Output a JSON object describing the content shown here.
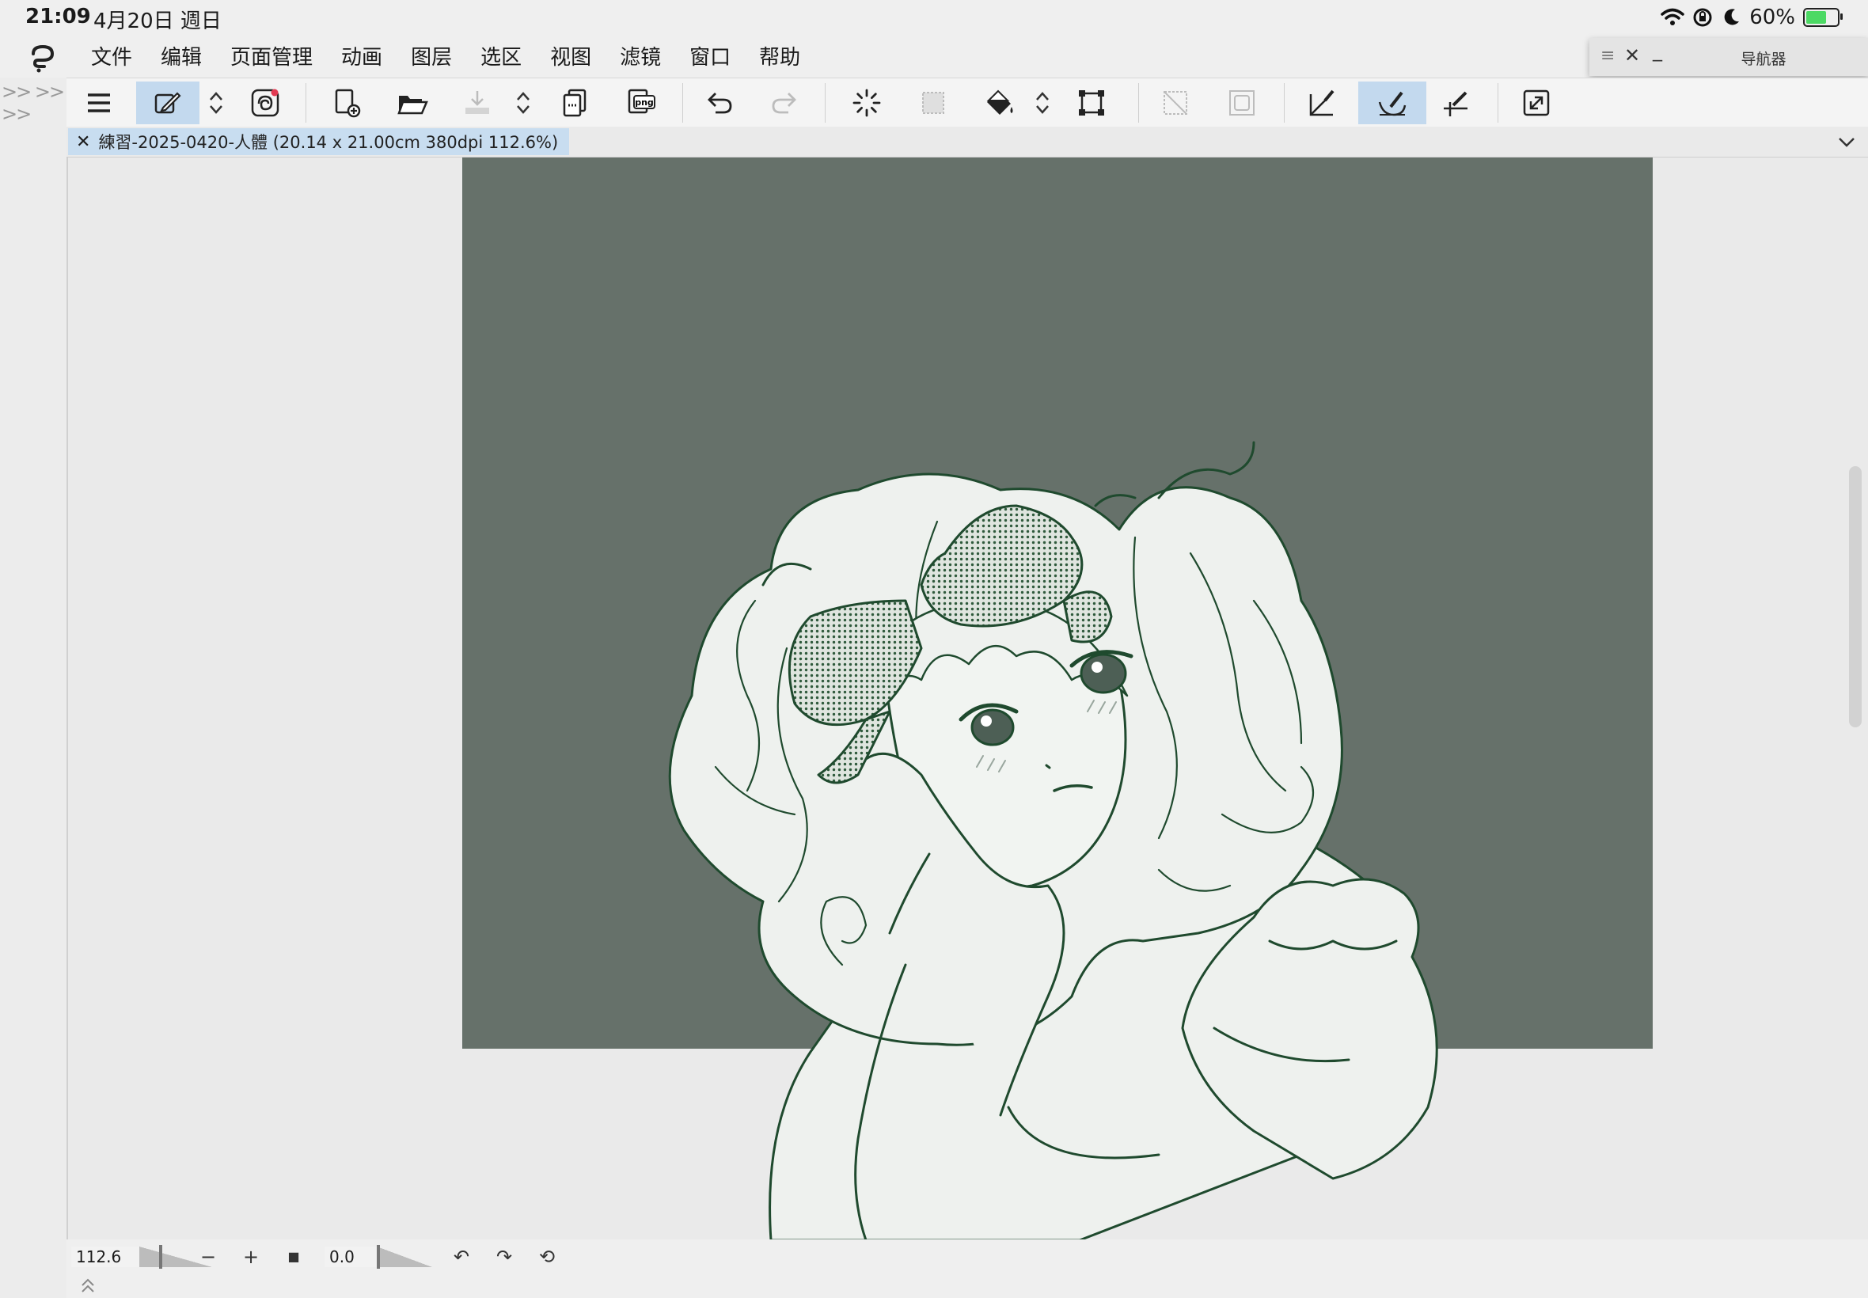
{
  "status": {
    "time": "21:09",
    "date": "4月20日 週日",
    "battery": "60%",
    "battery_level": 0.6
  },
  "menu": {
    "items": [
      "文件",
      "编辑",
      "页面管理",
      "动画",
      "图层",
      "选区",
      "视图",
      "滤镜",
      "窗口",
      "帮助"
    ]
  },
  "navigator": {
    "title": "导航器",
    "drag_icon": "≡",
    "close_icon": "✕",
    "minimize_icon": "_"
  },
  "dock": {
    "chevrons": ">> >> >>"
  },
  "commandbar": {
    "icons": [
      "menu-icon",
      "quick-access-icon",
      "up-down-icon",
      "companion-icon",
      "new-canvas-icon",
      "open-icon",
      "save-icon",
      "up-down-icon",
      "duplicate-icon",
      "export-png-icon",
      "undo-icon",
      "redo-icon",
      "loading-icon",
      "transform-selection-icon",
      "fill-icon",
      "up-down-icon",
      "crop-icon",
      "clear-selection-icon",
      "invert-selection-icon",
      "snap-ruler-icon",
      "snap-special-ruler-icon",
      "snap-grid-icon",
      "fullscreen-icon"
    ]
  },
  "canvas": {
    "tab_label": "練習-2025-0420-人體 (20.14 x 21.00cm 380dpi 112.6%)",
    "tab_close": "✕",
    "colors": {
      "background": "#66716a",
      "line": "#1f4a2e",
      "fill": "#eef1ee"
    }
  },
  "bottombar": {
    "zoom_value": "112.6",
    "zoom_out": "−",
    "zoom_in": "+",
    "fit": "■",
    "rotation_value": "0.0",
    "rotate_left": "↶",
    "rotate_right": "↷",
    "reset_rotation": "⟲"
  }
}
